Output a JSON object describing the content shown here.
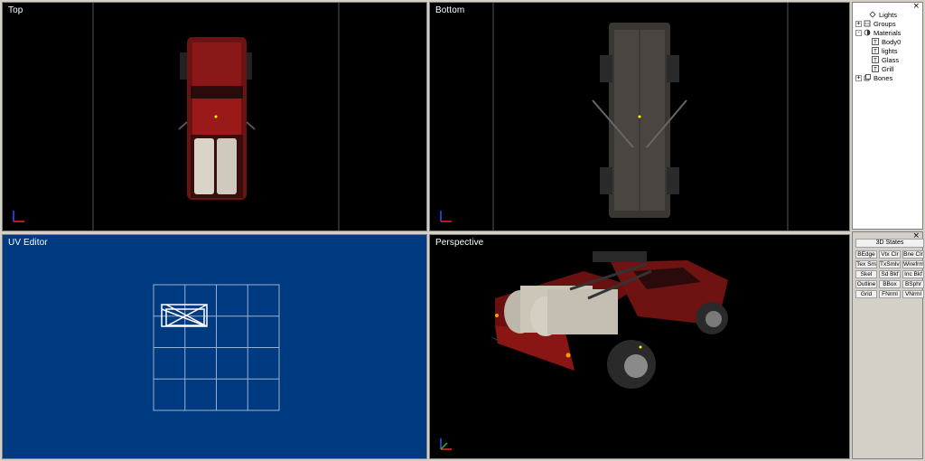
{
  "viewports": {
    "top": {
      "title": "Top"
    },
    "bottom": {
      "title": "Bottom"
    },
    "uv": {
      "title": "UV Editor"
    },
    "perspective": {
      "title": "Perspective"
    }
  },
  "tree": {
    "close_glyph": "×",
    "items": [
      {
        "label": "Lights",
        "expander": "",
        "icon": "light-icon"
      },
      {
        "label": "Groups",
        "expander": "+",
        "icon": "group-icon"
      },
      {
        "label": "Materials",
        "expander": "-",
        "icon": "material-icon"
      },
      {
        "label": "Body0",
        "expander": "",
        "icon": "texture-icon"
      },
      {
        "label": "lights",
        "expander": "",
        "icon": "texture-icon"
      },
      {
        "label": "Glass",
        "expander": "",
        "icon": "texture-icon"
      },
      {
        "label": "Grill",
        "expander": "",
        "icon": "texture-icon"
      },
      {
        "label": "Bones",
        "expander": "+",
        "icon": "bone-icon"
      }
    ]
  },
  "states": {
    "close_glyph": "×",
    "title": "3D States",
    "buttons": [
      "BEdge",
      "Vtx Clr",
      "Bne Clr",
      "Tex Sm",
      "TxSmlvlr",
      "Wirefrme",
      "Skel",
      "Sd Bkf",
      "Inc Bkf",
      "Outline",
      "BBox",
      "BSphr",
      "Grid",
      "FNrml",
      "VNrml"
    ]
  },
  "colors": {
    "viewport_bg": "#000000",
    "uv_bg": "#003a80",
    "truck_red": "#7a1414",
    "grid_line": "#555555"
  }
}
